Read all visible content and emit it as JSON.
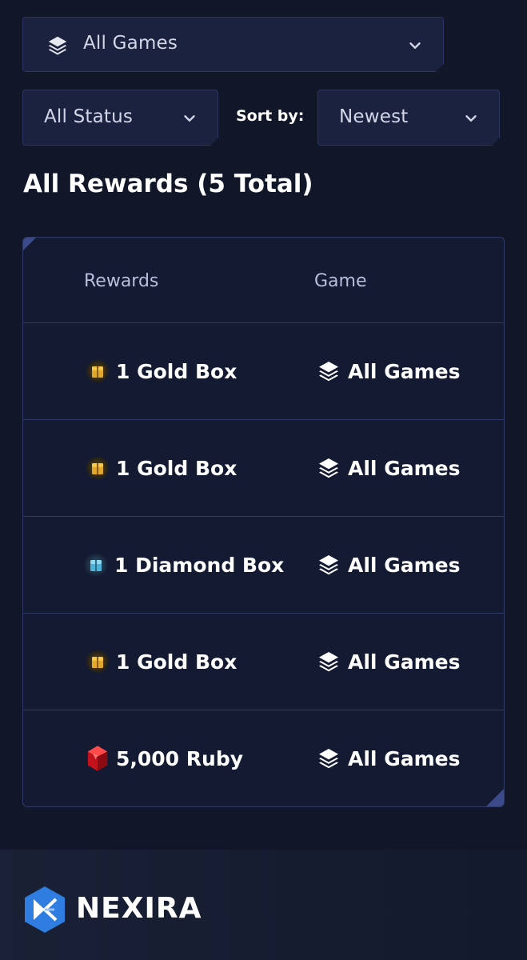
{
  "filters": {
    "game_select": {
      "value": "All Games"
    },
    "status_select": {
      "value": "All Status"
    },
    "sort_label": "Sort by:",
    "sort_select": {
      "value": "Newest"
    }
  },
  "section_title": "All Rewards (5 Total)",
  "table": {
    "headers": {
      "rewards": "Rewards",
      "game": "Game"
    },
    "rows": [
      {
        "reward": "1 Gold Box",
        "reward_icon": "gold-box-icon",
        "game": "All Games",
        "game_icon": "layers-icon"
      },
      {
        "reward": "1 Gold Box",
        "reward_icon": "gold-box-icon",
        "game": "All Games",
        "game_icon": "layers-icon"
      },
      {
        "reward": "1 Diamond Box",
        "reward_icon": "diamond-box-icon",
        "game": "All Games",
        "game_icon": "layers-icon"
      },
      {
        "reward": "1 Gold Box",
        "reward_icon": "gold-box-icon",
        "game": "All Games",
        "game_icon": "layers-icon"
      },
      {
        "reward": "5,000 Ruby",
        "reward_icon": "ruby-icon",
        "game": "All Games",
        "game_icon": "layers-icon"
      }
    ]
  },
  "footer": {
    "brand": "NEXIRA"
  },
  "colors": {
    "background": "#111629",
    "panel": "#1b2240",
    "border": "#2f3a66",
    "accent": "#2f7de1"
  }
}
